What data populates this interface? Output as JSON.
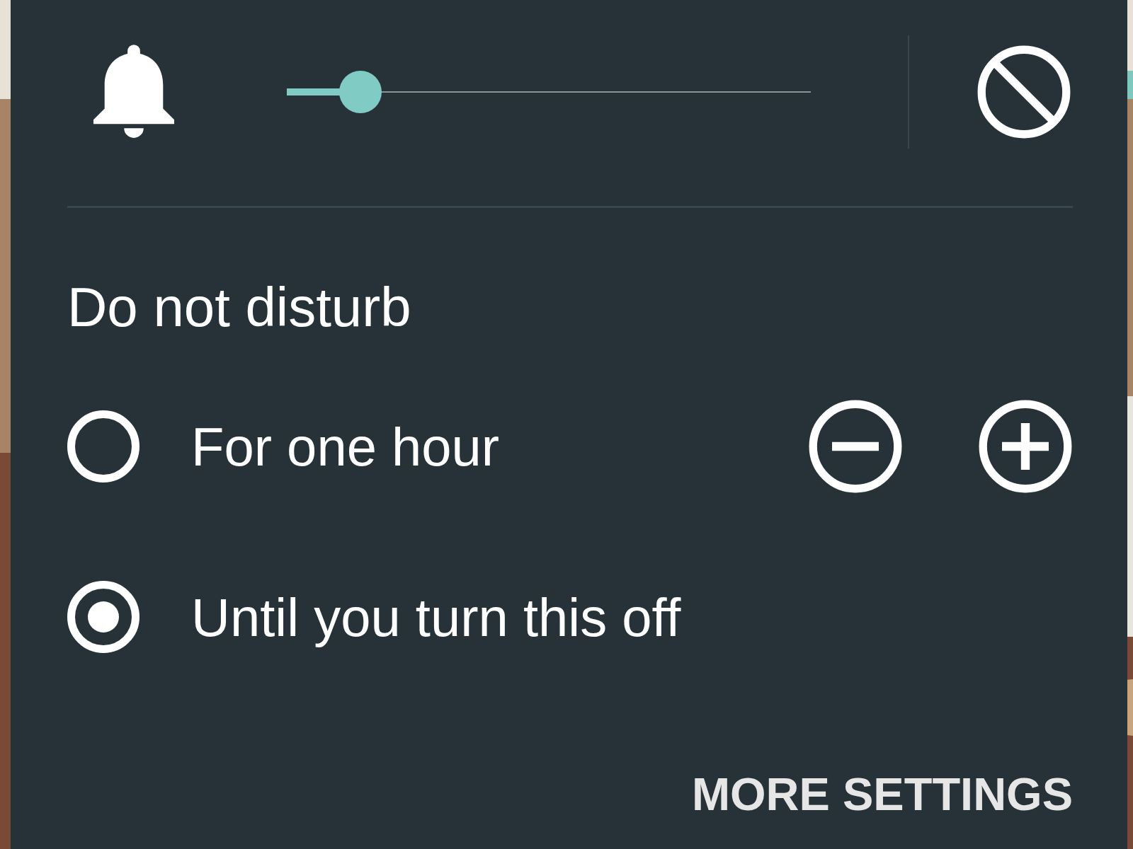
{
  "volume": {
    "level": 0.14
  },
  "title": "Do not disturb",
  "options": [
    {
      "label": "For one hour",
      "selected": false,
      "kind": "duration"
    },
    {
      "label": "Until you turn this off",
      "selected": true,
      "kind": "plain"
    }
  ],
  "action": "MORE SETTINGS"
}
